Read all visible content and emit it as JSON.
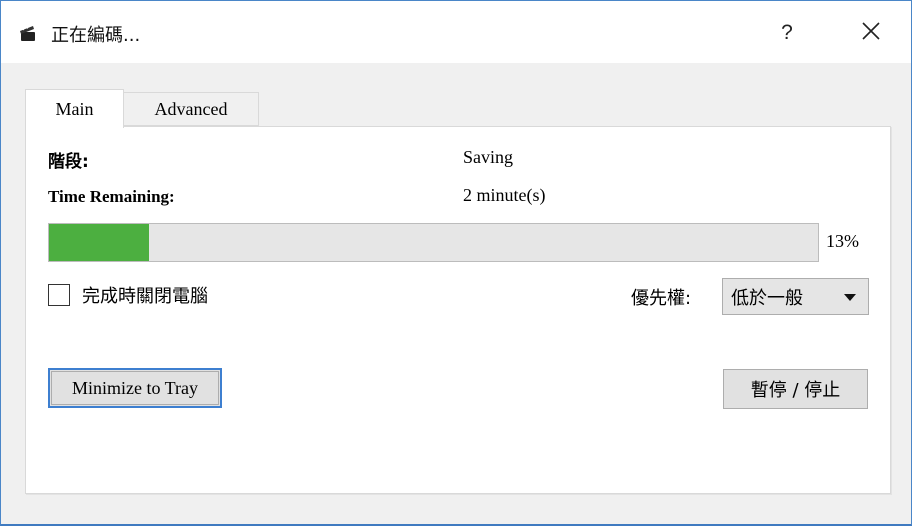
{
  "window": {
    "title": "正在編碼...",
    "title_icon": "clapperboard-icon",
    "help_label": "?",
    "close_icon": "close-icon"
  },
  "tabs": [
    {
      "label": "Main",
      "active": true
    },
    {
      "label": "Advanced",
      "active": false
    }
  ],
  "main": {
    "stage_label": "階段:",
    "stage_value": "Saving",
    "time_label": "Time Remaining:",
    "time_value": "2 minute(s)",
    "progress": {
      "percent": 13,
      "text": "13%",
      "fill_color": "#4caf40"
    },
    "shutdown_checkbox": {
      "label": "完成時關閉電腦",
      "checked": false
    },
    "priority": {
      "label": "優先權:",
      "selected": "低於一般"
    },
    "minimize_button": "Minimize to Tray",
    "pause_stop_button": "暫停 / 停止"
  },
  "colors": {
    "accent": "#3d7fd0",
    "window_border": "#4a86c8"
  }
}
